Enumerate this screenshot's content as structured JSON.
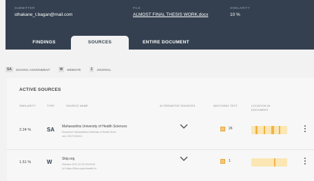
{
  "header": {
    "submitter": {
      "label": "SUBMITTER",
      "value": "sthakane_t.bagan@mail.com"
    },
    "file": {
      "label": "FILE",
      "value": "ALMOST FINAL THESIS WORK.docx"
    },
    "similarity": {
      "label": "SIMILARITY",
      "value": "10 %"
    }
  },
  "tabs": [
    {
      "label": "FINDINGS",
      "active": false
    },
    {
      "label": "SOURCES",
      "active": true
    },
    {
      "label": "ENTIRE DOCUMENT",
      "active": false
    }
  ],
  "filters": [
    {
      "badge": "SA",
      "label": "SCHOOL ASSIGNMENT"
    },
    {
      "badge": "W",
      "label": "WEBSITE"
    },
    {
      "badge": "J",
      "label": "JOURNAL"
    }
  ],
  "active_sources": {
    "title": "ACTIVE SOURCES",
    "columns": [
      "SIMILARITY",
      "TYPE",
      "SOURCE NAME",
      "ALTERNATIVE SOURCES",
      "MATCHING TEXT",
      "LOCATION IN DOCUMENT"
    ],
    "rows": [
      {
        "similarity": "2.24 %",
        "type": "SA",
        "name": "Maharashtra University of Health Sciences",
        "sub1": "Document: Maharashtra University of Health Scien",
        "sub2": "ces / 2017/1234/11",
        "matches": "26",
        "accent": "#f2b244"
      },
      {
        "similarity": "1.51 %",
        "type": "W",
        "name": "Skip.org",
        "sub1": "Fetched: 2017-10-21T18:00:00",
        "sub2": "Url: https://Skip.org/en/health/14",
        "matches": "1",
        "accent": "#f2b244"
      }
    ]
  }
}
